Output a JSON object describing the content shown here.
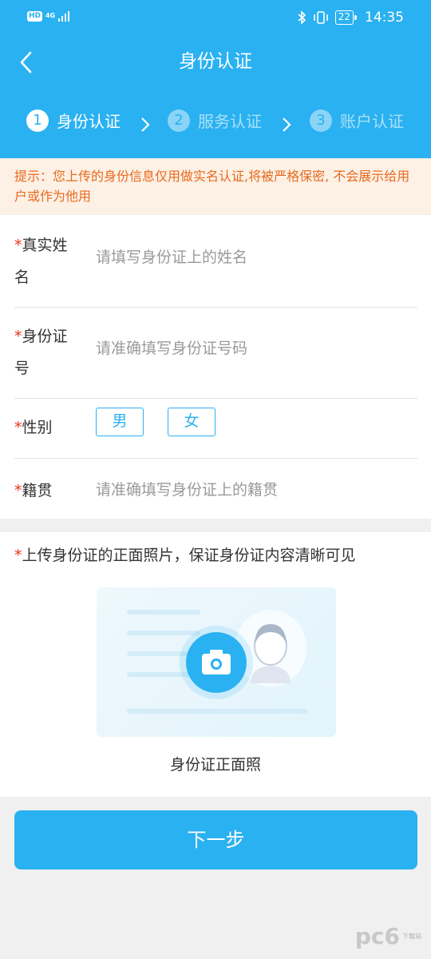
{
  "status_bar": {
    "hd_label": "HD",
    "network_label": "4G",
    "battery": "22",
    "time": "14:35"
  },
  "header": {
    "title": "身份认证",
    "steps": [
      {
        "num": "1",
        "label": "身份认证",
        "active": true
      },
      {
        "num": "2",
        "label": "服务认证",
        "active": false
      },
      {
        "num": "3",
        "label": "账户认证",
        "active": false
      }
    ]
  },
  "notice": {
    "text": "提示：您上传的身份信息仅用做实名认证,将被严格保密, 不会展示给用户或作为他用"
  },
  "form": {
    "required_mark": "*",
    "name": {
      "label_line1": "真实姓",
      "label_line2": "名",
      "placeholder": "请填写身份证上的姓名"
    },
    "id_number": {
      "label_line1": "身份证",
      "label_line2": "号",
      "placeholder": "请准确填写身份证号码"
    },
    "gender": {
      "label": "性别",
      "options": [
        "男",
        "女"
      ]
    },
    "native_place": {
      "label": "籍贯",
      "placeholder": "请准确填写身份证上的籍贯"
    }
  },
  "upload": {
    "title": "上传身份证的正面照片，保证身份证内容清晰可见",
    "caption": "身份证正面照"
  },
  "next_button": "下一步",
  "watermark": {
    "logo": "pc6",
    "sub": "下载站"
  },
  "colors": {
    "primary": "#2ab1f1",
    "notice_text": "#e8691d",
    "notice_bg": "#fdf1e6",
    "required": "#e8311b"
  }
}
